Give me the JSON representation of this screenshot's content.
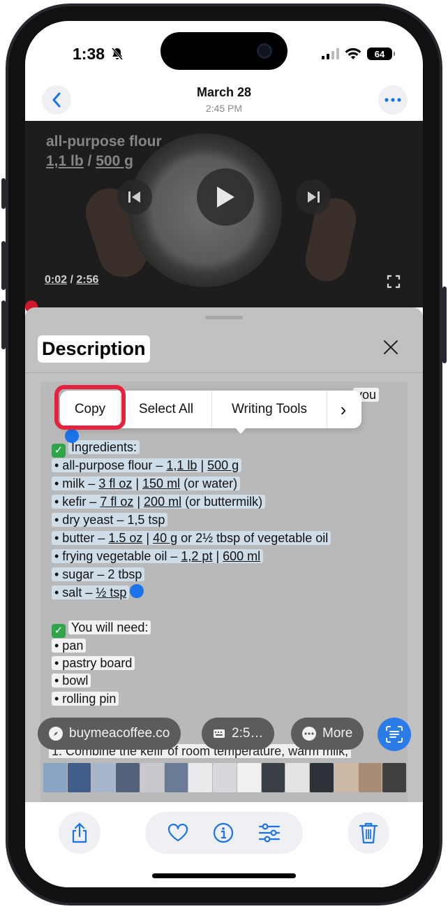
{
  "status_bar": {
    "time": "1:38",
    "battery": "64"
  },
  "nav": {
    "title": "March 28",
    "subtitle": "2:45 PM"
  },
  "video": {
    "caption_line1": "all-purpose flour",
    "caption_qty1": "1,1 lb",
    "caption_sep": " / ",
    "caption_qty2": "500 g",
    "current_time": "0:02",
    "time_sep": " / ",
    "duration": "2:56"
  },
  "sheet": {
    "title": "Description",
    "partial_top_right": "you",
    "ingredients_header": "Ingredients:",
    "ingredients": [
      {
        "pre": "• all-purpose flour – ",
        "a": "1,1 lb",
        "mid": " | ",
        "b": "500 g",
        "post": ""
      },
      {
        "pre": "• milk – ",
        "a": "3 fl oz",
        "mid": " | ",
        "b": "150 ml",
        "post": " (or water)"
      },
      {
        "pre": "• kefir – ",
        "a": "7 fl oz",
        "mid": " | ",
        "b": "200 ml",
        "post": " (or buttermilk)"
      },
      {
        "pre": "• dry yeast – 1,5 tsp",
        "a": "",
        "mid": "",
        "b": "",
        "post": ""
      },
      {
        "pre": "• butter – ",
        "a": "1.5 oz",
        "mid": " | ",
        "b": "40 g",
        "post": " or 2½ tbsp of vegetable oil"
      },
      {
        "pre": "• frying vegetable oil – ",
        "a": "1,2 pt",
        "mid": " | ",
        "b": "600 ml",
        "post": ""
      },
      {
        "pre": "• sugar – 2 tbsp",
        "a": "",
        "mid": "",
        "b": "",
        "post": ""
      },
      {
        "pre": "• salt – ",
        "a": "½ tsp",
        "mid": "",
        "b": "",
        "post": ""
      }
    ],
    "need_header": "You will need:",
    "need_items": [
      "• pan",
      "• pastry board",
      "• bowl",
      "• rolling pin"
    ],
    "bottom_line": "1. Combine the kefir of room temperature, warm milk,"
  },
  "popup": {
    "copy": "Copy",
    "select_all": "Select All",
    "writing_tools": "Writing Tools",
    "more_arrow": "›"
  },
  "pills": {
    "link": "buymeacoffee.co",
    "time": "2:5…",
    "more": "More"
  },
  "colors": {
    "accent": "#1a73e8",
    "highlight_ring": "#e6233f",
    "selection": "#cfdde9",
    "check_green": "#2fa44a"
  },
  "icons": [
    "back-chevron-icon",
    "ellipsis-icon",
    "previous-icon",
    "play-icon",
    "next-icon",
    "fullscreen-icon",
    "close-icon",
    "compass-icon",
    "keyboard-icon",
    "ellipsis-bubble-icon",
    "live-text-icon",
    "share-icon",
    "heart-icon",
    "info-icon",
    "adjust-icon",
    "trash-icon"
  ]
}
